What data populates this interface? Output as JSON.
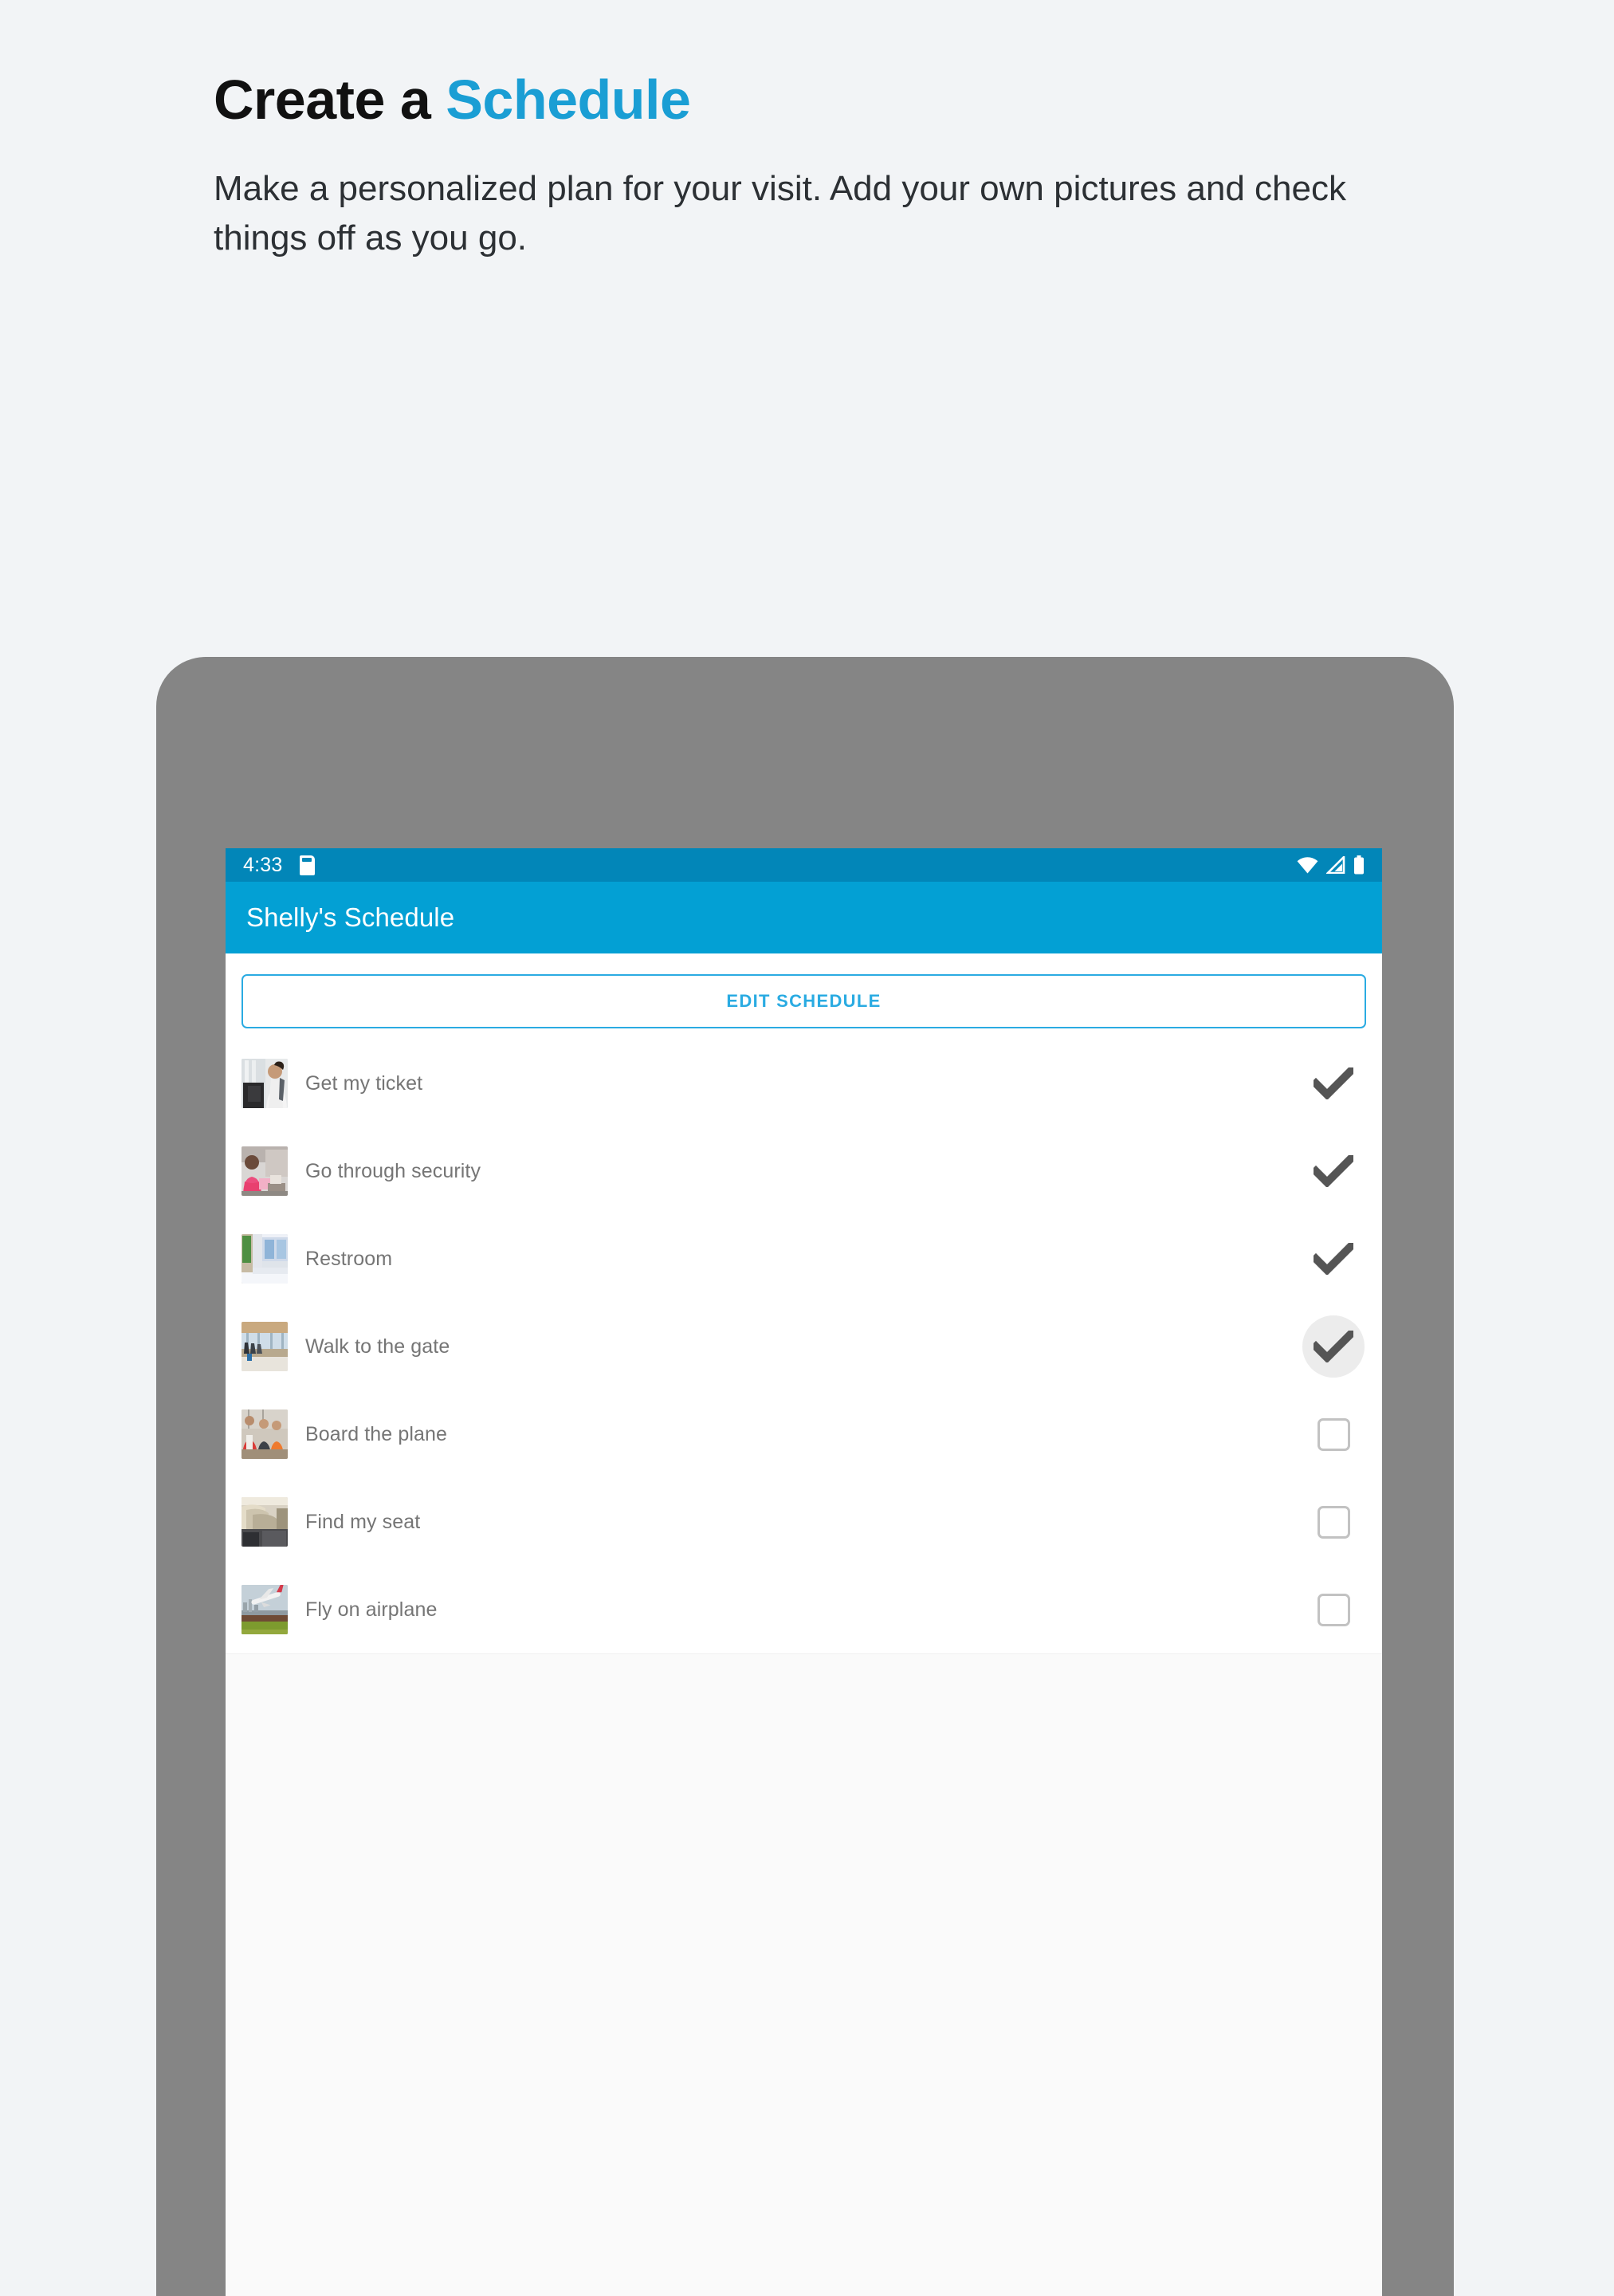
{
  "hero": {
    "title_plain": "Create a ",
    "title_accent": "Schedule",
    "subtitle": "Make a personalized plan for your visit. Add your own pictures and check things off as you go."
  },
  "colors": {
    "accent": "#1a9ed4",
    "appbar": "#03a0d4",
    "statusbar": "#0286b8",
    "page_background": "#f2f4f6",
    "bezel": "#858585",
    "button_border": "#2aabe2",
    "label_text": "#757575",
    "check_dark": "#555555",
    "checkbox_border": "#c2c2c2"
  },
  "phone": {
    "statusbar": {
      "time": "4:33",
      "icons": [
        "sd-card-icon",
        "wifi-icon",
        "cellular-signal-icon",
        "battery-icon"
      ]
    },
    "appbar": {
      "title": "Shelly's Schedule"
    },
    "edit_button": {
      "label": "EDIT SCHEDULE"
    },
    "tasks": [
      {
        "label": "Get my ticket",
        "checked": true,
        "pressed": false,
        "thumb": "ticket-kiosk-photo"
      },
      {
        "label": "Go through security",
        "checked": true,
        "pressed": false,
        "thumb": "security-line-photo"
      },
      {
        "label": "Restroom",
        "checked": true,
        "pressed": false,
        "thumb": "restroom-corridor-photo"
      },
      {
        "label": "Walk to the gate",
        "checked": true,
        "pressed": true,
        "thumb": "terminal-walkway-photo"
      },
      {
        "label": "Board the plane",
        "checked": false,
        "pressed": false,
        "thumb": "boarding-staff-photo"
      },
      {
        "label": "Find my seat",
        "checked": false,
        "pressed": false,
        "thumb": "cabin-seats-photo"
      },
      {
        "label": "Fly on airplane",
        "checked": false,
        "pressed": false,
        "thumb": "airplane-takeoff-photo"
      }
    ]
  }
}
